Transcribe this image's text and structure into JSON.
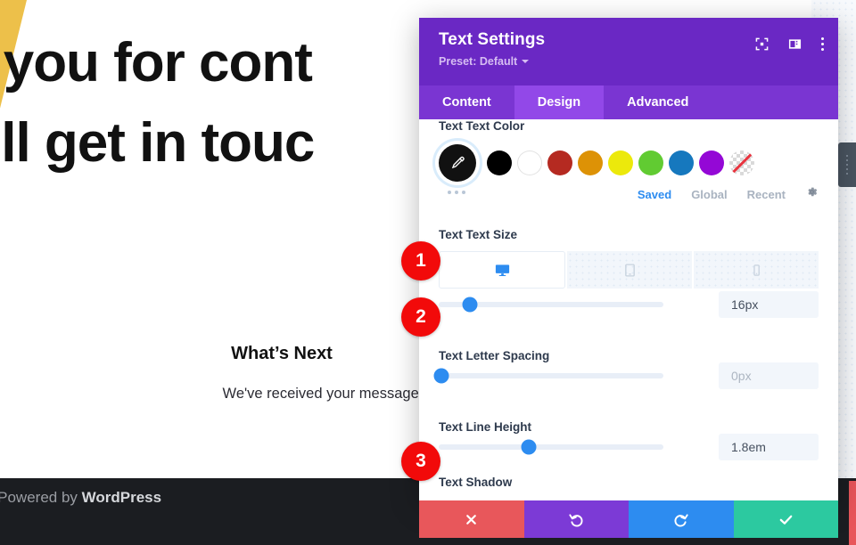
{
  "page": {
    "hero_heading": "k you for cont\ne'll get in touc",
    "whats_next_title": "What’s Next",
    "whats_next_body": "We've received your message and we'll send you an email with",
    "footer_prefix": "| Powered by ",
    "footer_brand": "WordPress"
  },
  "modal": {
    "title": "Text Settings",
    "preset": "Preset: Default",
    "header_icons": [
      {
        "name": "focus-target-icon"
      },
      {
        "name": "layout-panel-icon"
      },
      {
        "name": "more-options-icon"
      }
    ],
    "tabs": [
      {
        "label": "Content",
        "active": false
      },
      {
        "label": "Design",
        "active": true
      },
      {
        "label": "Advanced",
        "active": false
      }
    ],
    "color_field": {
      "label": "Text Text Color",
      "picker_icon": "eyedropper-icon",
      "swatches": [
        {
          "name": "swatch-black",
          "color": "#000000"
        },
        {
          "name": "swatch-white",
          "color": "#ffffff"
        },
        {
          "name": "swatch-dark-red",
          "color": "#b52a21"
        },
        {
          "name": "swatch-orange",
          "color": "#dd9206"
        },
        {
          "name": "swatch-yellow",
          "color": "#ece90b"
        },
        {
          "name": "swatch-green",
          "color": "#61cb32"
        },
        {
          "name": "swatch-blue",
          "color": "#1678be"
        },
        {
          "name": "swatch-purple",
          "color": "#9408d6"
        },
        {
          "name": "swatch-transparent",
          "color": "transparent"
        }
      ],
      "palette_tabs": [
        {
          "label": "Saved",
          "active": true
        },
        {
          "label": "Global",
          "active": false
        },
        {
          "label": "Recent",
          "active": false
        }
      ],
      "settings_icon": "gear-icon"
    },
    "size_field": {
      "label": "Text Text Size",
      "devices": [
        {
          "name": "desktop-icon",
          "active": true
        },
        {
          "name": "tablet-icon",
          "active": false
        },
        {
          "name": "phone-icon",
          "active": false
        }
      ],
      "value": "16px",
      "slider_percent": 14
    },
    "letter_spacing_field": {
      "label": "Text Letter Spacing",
      "value": "0px",
      "placeholder": "0px",
      "slider_percent": 1
    },
    "line_height_field": {
      "label": "Text Line Height",
      "value": "1.8em",
      "slider_percent": 40
    },
    "shadow_field": {
      "label": "Text Shadow"
    },
    "actions": [
      {
        "name": "cancel-button",
        "icon": "✕",
        "color": "#e8575b"
      },
      {
        "name": "undo-button",
        "icon": "↺",
        "color": "#7c3ad6"
      },
      {
        "name": "redo-button",
        "icon": "↻",
        "color": "#2d8cf0"
      },
      {
        "name": "save-button",
        "icon": "✓",
        "color": "#2cc9a0"
      }
    ]
  },
  "annotations": [
    {
      "number": "1"
    },
    {
      "number": "2"
    },
    {
      "number": "3"
    }
  ]
}
